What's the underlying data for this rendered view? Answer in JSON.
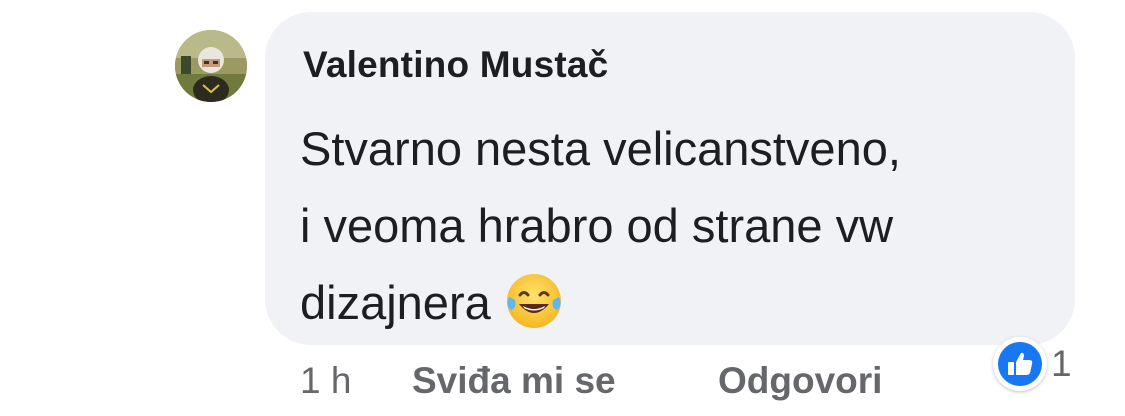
{
  "comment": {
    "author": "Valentino Mustač",
    "text_lines": [
      "Stvarno nesta velicanstveno,",
      "i veoma hrabro od strane vw",
      "dizajnera"
    ],
    "emoji": "face-with-tears-of-joy-icon",
    "avatar_icon": "avatar-photo-icon"
  },
  "footer": {
    "time": "1 h",
    "like_label": "Sviđa mi se",
    "reply_label": "Odgovori"
  },
  "reaction": {
    "icon": "like-thumbs-up-icon",
    "count": "1"
  },
  "colors": {
    "bubble": "#f0f2f5",
    "text": "#1c1e21",
    "secondary_text": "#65676b",
    "like_blue": "#1877f2"
  }
}
